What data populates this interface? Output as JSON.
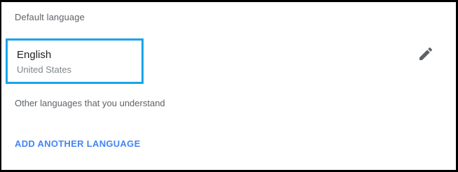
{
  "section": {
    "default_label": "Default language",
    "other_label": "Other languages that you understand"
  },
  "default_language": {
    "name": "English",
    "region": "United States",
    "highlight_color": "#1aa3e8",
    "edit_icon": "pencil-icon"
  },
  "actions": {
    "add_language_label": "ADD ANOTHER LANGUAGE",
    "link_color": "#4285f4"
  }
}
